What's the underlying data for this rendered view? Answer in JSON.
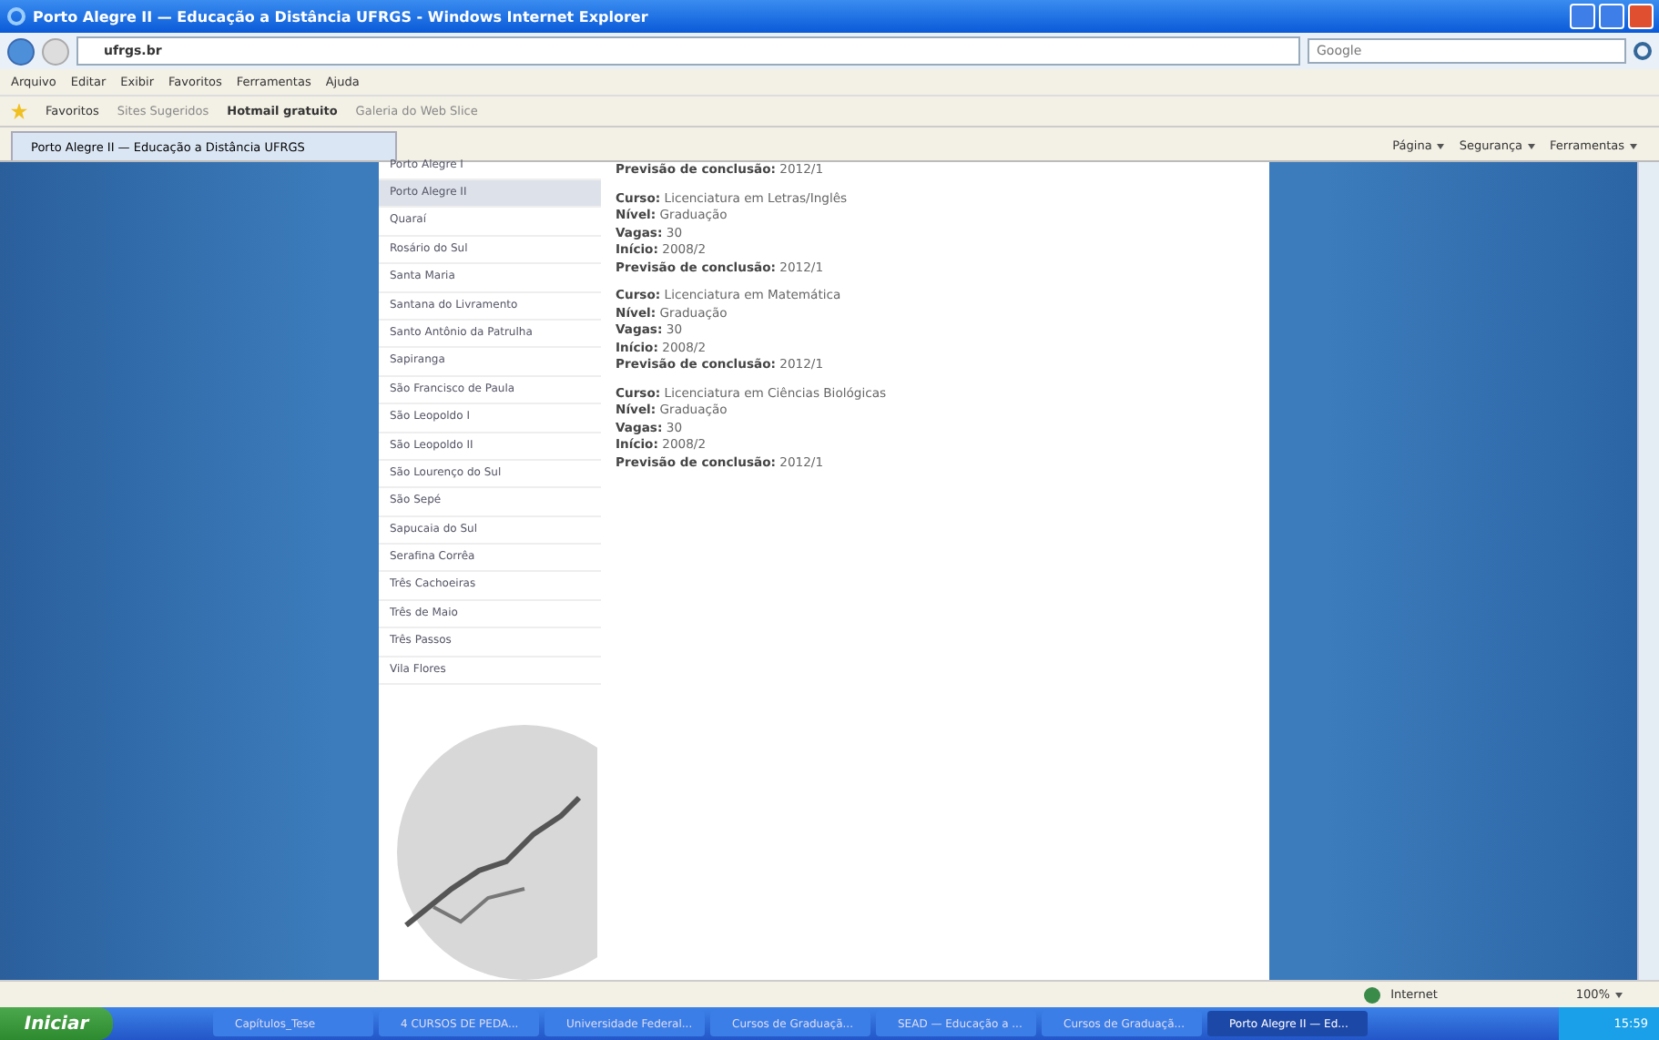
{
  "window": {
    "title": "Porto Alegre II — Educação a Distância UFRGS - Windows Internet Explorer"
  },
  "address_bar": {
    "value": "ufrgs.br",
    "search_placeholder": "Google"
  },
  "menu": [
    "Arquivo",
    "Editar",
    "Exibir",
    "Favoritos",
    "Ferramentas",
    "Ajuda"
  ],
  "favorites_bar": {
    "favorites": "Favoritos",
    "links": [
      "Sites Sugeridos",
      "Hotmail gratuito",
      "Galeria do Web Slice"
    ]
  },
  "tab": {
    "label": "Porto Alegre II — Educação a Distância UFRGS"
  },
  "command_bar": [
    "Página",
    "Segurança",
    "Ferramentas"
  ],
  "sidebar": {
    "items": [
      {
        "label": "Porto Alegre I",
        "selected": false
      },
      {
        "label": "Porto Alegre II",
        "selected": true
      },
      {
        "label": "Quaraí",
        "selected": false
      },
      {
        "label": "Rosário do Sul",
        "selected": false
      },
      {
        "label": "Santa Maria",
        "selected": false
      },
      {
        "label": "Santana do Livramento",
        "selected": false
      },
      {
        "label": "Santo Antônio da Patrulha",
        "selected": false
      },
      {
        "label": "Sapiranga",
        "selected": false
      },
      {
        "label": "São Francisco de Paula",
        "selected": false
      },
      {
        "label": "São Leopoldo I",
        "selected": false
      },
      {
        "label": "São Leopoldo II",
        "selected": false
      },
      {
        "label": "São Lourenço do Sul",
        "selected": false
      },
      {
        "label": "São Sepé",
        "selected": false
      },
      {
        "label": "Sapucaia do Sul",
        "selected": false
      },
      {
        "label": "Serafina Corrêa",
        "selected": false
      },
      {
        "label": "Três Cachoeiras",
        "selected": false
      },
      {
        "label": "Três de Maio",
        "selected": false
      },
      {
        "label": "Três Passos",
        "selected": false
      },
      {
        "label": "Vila Flores",
        "selected": false
      }
    ]
  },
  "content": {
    "lead": "**Previsão de conclusão:** 2012/1",
    "courses": [
      {
        "lines": [
          "**Curso:** Licenciatura em Letras/Inglês",
          "**Nível:** Graduação",
          "**Vagas:** 30",
          "**Início:** 2008/2",
          "**Previsão de conclusão:** 2012/1"
        ]
      },
      {
        "lines": [
          "**Curso:** Licenciatura em Matemática",
          "**Nível:** Graduação",
          "**Vagas:** 30",
          "**Início:** 2008/2",
          "**Previsão de conclusão:** 2012/1"
        ]
      },
      {
        "lines": [
          "**Curso:** Licenciatura em Ciências Biológicas",
          "**Nível:** Graduação",
          "**Vagas:** 30",
          "**Início:** 2008/2",
          "**Previsão de conclusão:** 2012/1"
        ]
      }
    ]
  },
  "status_bar": {
    "zone": "Internet",
    "zoom": "100%"
  },
  "taskbar": {
    "start": "Iniciar",
    "tasks": [
      {
        "label": "Capítulos_Tese",
        "selected": false
      },
      {
        "label": "4 CURSOS DE PEDA...",
        "selected": false
      },
      {
        "label": "Universidade Federal...",
        "selected": false
      },
      {
        "label": "Cursos de Graduaçã...",
        "selected": false
      },
      {
        "label": "SEAD — Educação a ...",
        "selected": false
      },
      {
        "label": "Cursos de Graduaçã...",
        "selected": false
      },
      {
        "label": "Porto Alegre II — Ed...",
        "selected": true
      }
    ],
    "clock": "15:59"
  }
}
